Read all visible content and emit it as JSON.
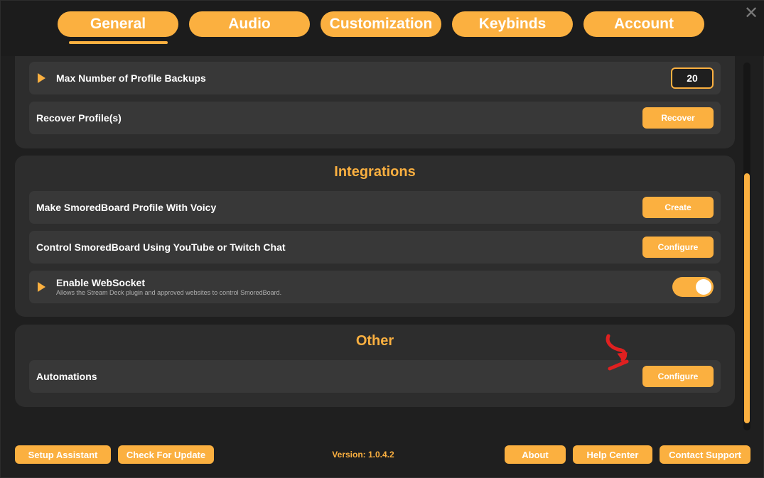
{
  "tabs": [
    {
      "label": "General",
      "active": true
    },
    {
      "label": "Audio",
      "active": false
    },
    {
      "label": "Customization",
      "active": false
    },
    {
      "label": "Keybinds",
      "active": false
    },
    {
      "label": "Account",
      "active": false
    }
  ],
  "close_icon": "close-icon",
  "profile_section": {
    "max_backups": {
      "label": "Max Number of Profile Backups",
      "value": "20"
    },
    "recover": {
      "label": "Recover Profile(s)",
      "button": "Recover"
    }
  },
  "integrations": {
    "title": "Integrations",
    "voicy": {
      "label": "Make SmoredBoard Profile With Voicy",
      "button": "Create"
    },
    "chat": {
      "label": "Control SmoredBoard Using YouTube or Twitch Chat",
      "button": "Configure"
    },
    "websocket": {
      "label": "Enable WebSocket",
      "description": "Allows the Stream Deck plugin and approved websites to control SmoredBoard.",
      "enabled": true
    }
  },
  "other": {
    "title": "Other",
    "automations": {
      "label": "Automations",
      "button": "Configure"
    }
  },
  "footer": {
    "setup_assistant": "Setup Assistant",
    "check_update": "Check For Update",
    "version": "Version: 1.0.4.2",
    "about": "About",
    "help_center": "Help Center",
    "contact_support": "Contact Support"
  },
  "colors": {
    "accent": "#fbb040",
    "background": "#1f1f1f",
    "panel": "#2d2d2d",
    "row": "#383838",
    "annotation": "#e02020"
  }
}
